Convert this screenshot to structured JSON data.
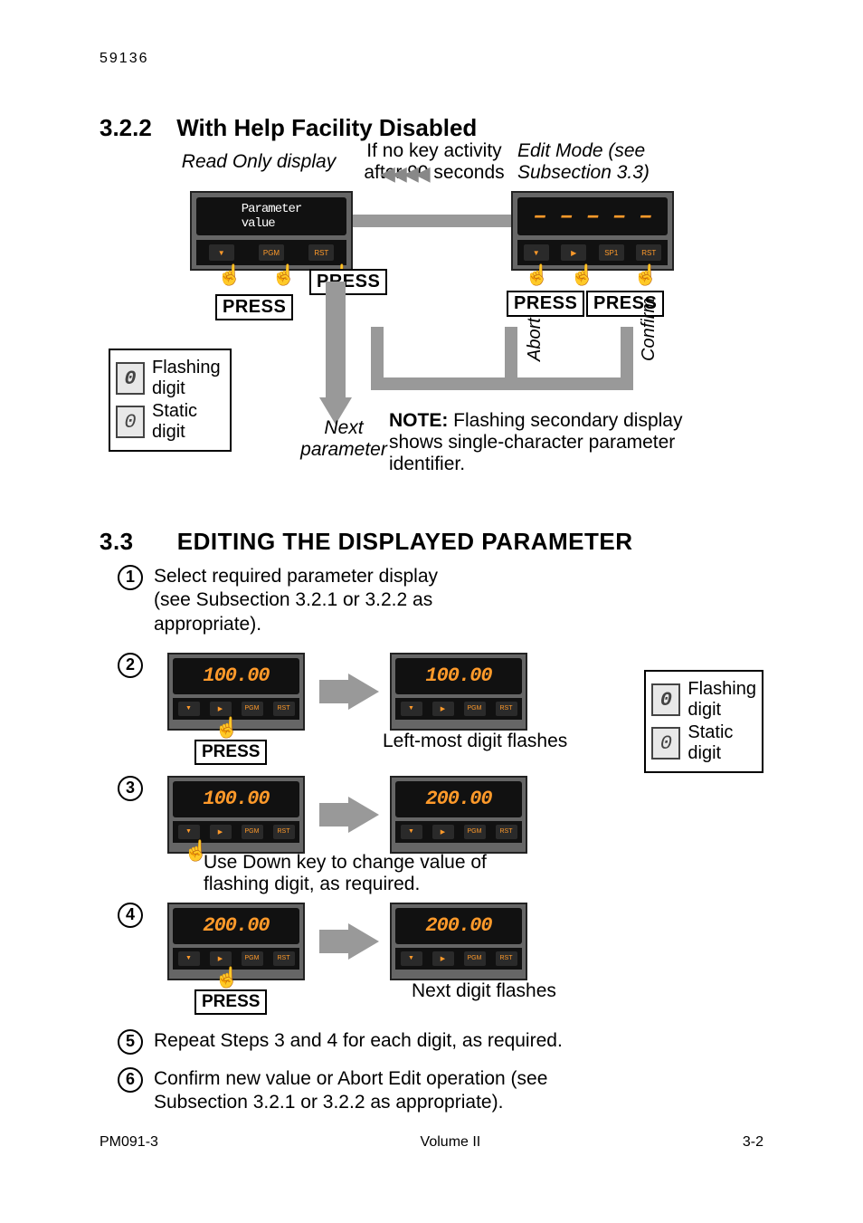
{
  "header_number": "59136",
  "section_322": {
    "number": "3.2.2",
    "title": "With Help Facility Disabled"
  },
  "diagram322": {
    "read_only_label": "Read Only display",
    "if_no_key": "If no key activity\nafter 90 seconds",
    "edit_mode": "Edit Mode (see\nSubsection 3.3)",
    "param_value": "Parameter\nvalue",
    "display_dashes": "– – – – –",
    "press": "PRESS",
    "abort": "Abort",
    "confirm": "Confirm",
    "next_parameter": "Next\nparameter",
    "note": "NOTE: Flashing secondary display shows single-character parameter identifier.",
    "note_prefix": "NOTE:",
    "note_rest": " Flashing secondary display shows single-character parameter identifier.",
    "legend": {
      "flashing": "Flashing\ndigit",
      "static": "Static\ndigit"
    }
  },
  "section_33": {
    "number": "3.3",
    "title": "EDITING THE DISPLAYED PARAMETER"
  },
  "steps": {
    "s1": "Select required parameter display (see Subsection 3.2.1 or 3.2.2 as appropriate).",
    "s2_caption": "Left-most digit flashes",
    "s2_press": "PRESS",
    "s2_display_a": "100.00",
    "s2_display_b": "100.00",
    "s3_caption": "Use Down key to change value of flashing digit, as required.",
    "s3_display_a": "100.00",
    "s3_display_b": "200.00",
    "s4_caption": "Next digit flashes",
    "s4_press": "PRESS",
    "s4_display_a": "200.00",
    "s4_display_b": "200.00",
    "s5": "Repeat Steps 3 and 4 for each digit, as required.",
    "s6": "Confirm new value or Abort Edit operation (see Subsection 3.2.1 or 3.2.2 as appropriate)."
  },
  "legend33": {
    "flashing": "Flashing\ndigit",
    "static": "Static\ndigit"
  },
  "footer": {
    "left": "PM091-3",
    "center": "Volume II",
    "right": "3-2"
  }
}
